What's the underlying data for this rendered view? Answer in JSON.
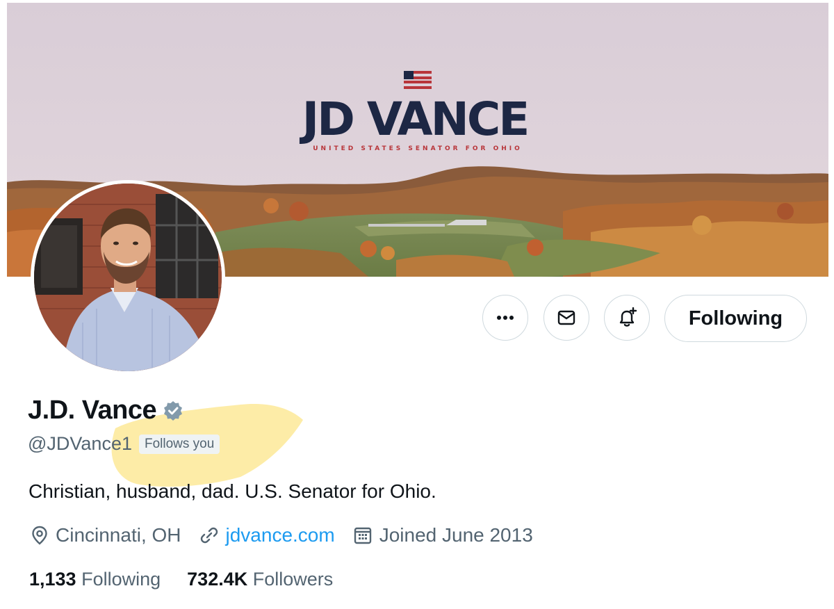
{
  "banner": {
    "brand_name": "JD VANCE",
    "brand_subtitle": "UNITED STATES SENATOR FOR OHIO"
  },
  "actions": {
    "more_icon": "more-horizontal-icon",
    "message_icon": "envelope-icon",
    "notify_icon": "bell-plus-icon",
    "follow_state": "Following"
  },
  "profile": {
    "name": "J.D. Vance",
    "verified_icon": "verified-badge-icon",
    "handle": "@JDVance1",
    "follows_you": "Follows you",
    "bio": "Christian, husband, dad. U.S. Senator for Ohio.",
    "location": "Cincinnati, OH",
    "website": "jdvance.com",
    "joined": "Joined June 2013"
  },
  "stats": {
    "following_count": "1,133",
    "following_label": "Following",
    "followers_count": "732.4K",
    "followers_label": "Followers"
  },
  "colors": {
    "accent": "#1d9bf0",
    "brand_navy": "#1d2744",
    "brand_red": "#b8353a",
    "highlight": "#fce68a"
  }
}
